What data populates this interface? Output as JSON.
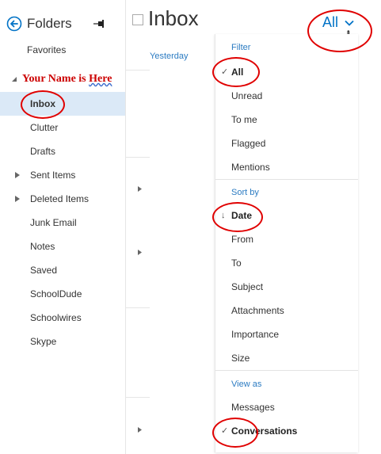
{
  "sidebar": {
    "header": {
      "title": "Folders"
    },
    "favorites_label": "Favorites",
    "account_name": {
      "text": "Your Name is ",
      "squiggle": "Here"
    },
    "folders": [
      {
        "label": "Inbox",
        "selected": true,
        "expandable": false
      },
      {
        "label": "Clutter",
        "selected": false,
        "expandable": false
      },
      {
        "label": "Drafts",
        "selected": false,
        "expandable": false
      },
      {
        "label": "Sent Items",
        "selected": false,
        "expandable": true
      },
      {
        "label": "Deleted Items",
        "selected": false,
        "expandable": true
      },
      {
        "label": "Junk Email",
        "selected": false,
        "expandable": false
      },
      {
        "label": "Notes",
        "selected": false,
        "expandable": false
      },
      {
        "label": "Saved",
        "selected": false,
        "expandable": false
      },
      {
        "label": "SchoolDude",
        "selected": false,
        "expandable": false
      },
      {
        "label": "Schoolwires",
        "selected": false,
        "expandable": false
      },
      {
        "label": "Skype",
        "selected": false,
        "expandable": false
      }
    ]
  },
  "main": {
    "title": "Inbox",
    "filter_toggle_label": "All",
    "date_group": "Yesterday"
  },
  "dropdown": {
    "filter": {
      "header": "Filter",
      "items": [
        "All",
        "Unread",
        "To me",
        "Flagged",
        "Mentions"
      ],
      "checked": "All"
    },
    "sort_by": {
      "header": "Sort by",
      "items": [
        "Date",
        "From",
        "To",
        "Subject",
        "Attachments",
        "Importance",
        "Size"
      ],
      "checked": "Date"
    },
    "view_as": {
      "header": "View as",
      "items": [
        "Messages",
        "Conversations"
      ],
      "checked": "Conversations"
    }
  },
  "icons": {
    "back": "back-arrow-circle-icon",
    "pin": "pin-icon",
    "account_caret": "triangle-down-icon",
    "folder_expander": "triangle-right-icon",
    "filter_chevron": "chevron-down-icon",
    "cursor": "hand-cursor-icon",
    "check": "checkmark-icon",
    "sort_direction": "arrow-down-icon"
  },
  "colors": {
    "accent": "#0072c6",
    "selected_bg": "#dbe9f7",
    "annotation": "#e00000",
    "account_name": "#cc0000"
  }
}
